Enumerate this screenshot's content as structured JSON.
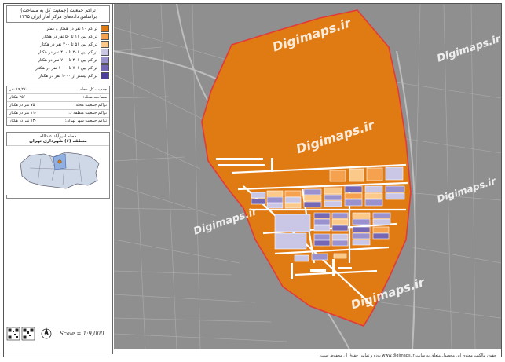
{
  "legend": {
    "title_line1": "تراکم جمعیت (جمعیت کل به مساحت)",
    "title_line2": "براساس داده‌های مرکز آمار ایران ۱۳۹۵",
    "items": [
      {
        "label": "تراکم ۱۰ نفر در هکتار و کمتر",
        "color": "#e07a12"
      },
      {
        "label": "تراکم بین ۱۱ تا ۵۰ نفر در هکتار",
        "color": "#f5a14d"
      },
      {
        "label": "تراکم بین ۵۱ تا ۲۰۰ نفر در هکتار",
        "color": "#fbc98a"
      },
      {
        "label": "تراکم بین ۲۰۱ تا ۴۰۰ نفر در هکتار",
        "color": "#c9c6e6"
      },
      {
        "label": "تراکم بین ۴۰۱ تا ۷۰۰ نفر در هکتار",
        "color": "#9a92cf"
      },
      {
        "label": "تراکم بین ۷۰۱ تا ۱۰۰۰ نفر در هکتار",
        "color": "#7468b5"
      },
      {
        "label": "تراکم بیشتر از ۱۰۰۰ نفر در هکتار",
        "color": "#4b3f99"
      }
    ]
  },
  "stats": [
    {
      "label": "جمعیت کل محله:",
      "value": "۱۹,۲۷۰ نفر"
    },
    {
      "label": "مساحت محله:",
      "value": "۲۵۶ هکتار"
    },
    {
      "label": "تراکم جمعیت محله:",
      "value": "۷۵ نفر در هکتار"
    },
    {
      "label": "تراکم جمعیت منطقه ۶:",
      "value": "۱۱۰ نفر در هکتار"
    },
    {
      "label": "تراکم جمعیت شهر تهران:",
      "value": "۱۳۰ نفر در هکتار"
    }
  ],
  "inset": {
    "line1": "محله امیرآباد عبدالله",
    "line2": "منطقه (۶) شهرداری تهران"
  },
  "scale": {
    "label": "Scale = 1:9,000",
    "north": "N"
  },
  "watermark": "Digimaps.ir",
  "footer": "حقوق مالکیت معنوی این محصول متعلق به سایت www.digimaps.ir بوده و تمامی حقوق آن محفوظ است.",
  "colors": {
    "map_bg": "#8f8f8f",
    "orange": "#e07a12",
    "boundary": "#e23a3a"
  }
}
